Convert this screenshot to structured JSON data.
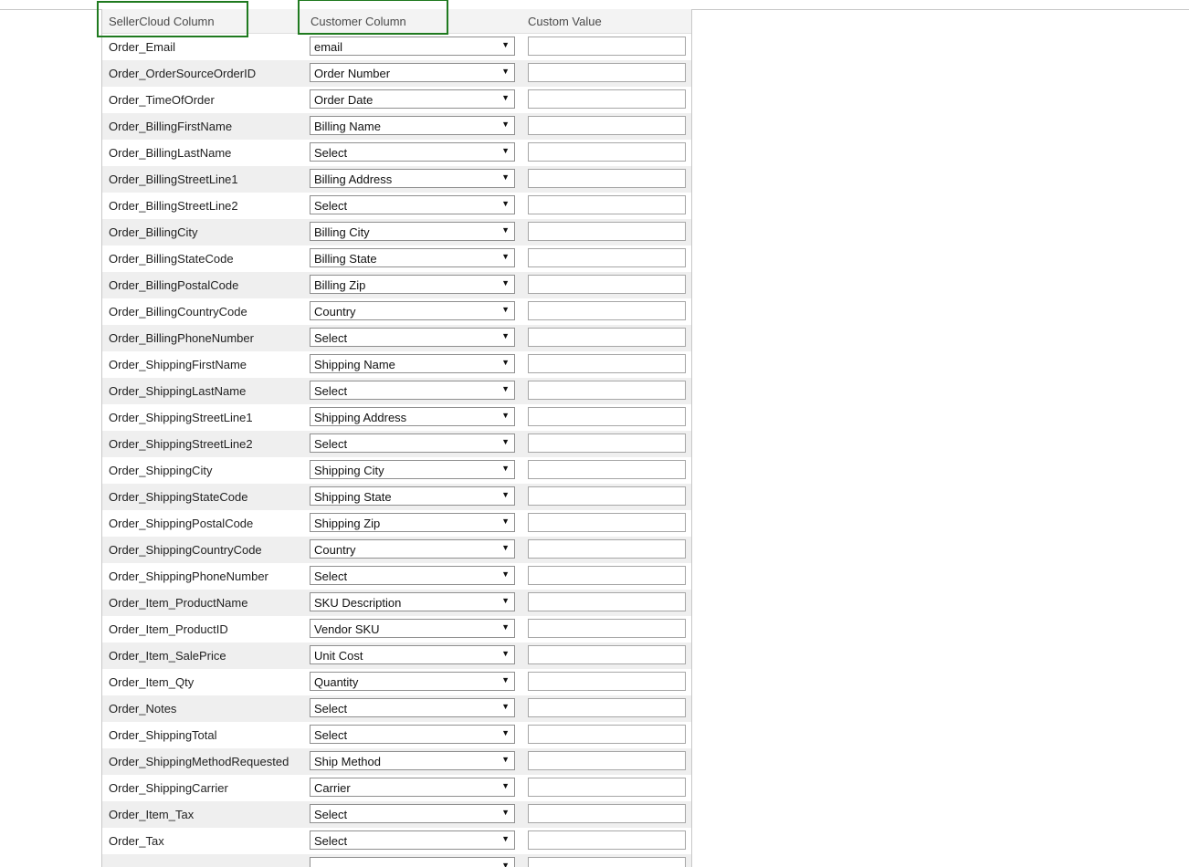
{
  "header": {
    "seller_col": "SellerCloud Column",
    "customer_col": "Customer Column",
    "custom_col": "Custom Value"
  },
  "rows": [
    {
      "field": "Order_Email",
      "mapped": "email",
      "custom": ""
    },
    {
      "field": "Order_OrderSourceOrderID",
      "mapped": "Order Number",
      "custom": ""
    },
    {
      "field": "Order_TimeOfOrder",
      "mapped": "Order Date",
      "custom": ""
    },
    {
      "field": "Order_BillingFirstName",
      "mapped": "Billing Name",
      "custom": ""
    },
    {
      "field": "Order_BillingLastName",
      "mapped": "Select",
      "custom": ""
    },
    {
      "field": "Order_BillingStreetLine1",
      "mapped": "Billing Address",
      "custom": ""
    },
    {
      "field": "Order_BillingStreetLine2",
      "mapped": "Select",
      "custom": ""
    },
    {
      "field": "Order_BillingCity",
      "mapped": "Billing City",
      "custom": ""
    },
    {
      "field": "Order_BillingStateCode",
      "mapped": "Billing State",
      "custom": ""
    },
    {
      "field": "Order_BillingPostalCode",
      "mapped": "Billing Zip",
      "custom": ""
    },
    {
      "field": "Order_BillingCountryCode",
      "mapped": "Country",
      "custom": ""
    },
    {
      "field": "Order_BillingPhoneNumber",
      "mapped": "Select",
      "custom": ""
    },
    {
      "field": "Order_ShippingFirstName",
      "mapped": "Shipping Name",
      "custom": ""
    },
    {
      "field": "Order_ShippingLastName",
      "mapped": "Select",
      "custom": ""
    },
    {
      "field": "Order_ShippingStreetLine1",
      "mapped": "Shipping Address",
      "custom": ""
    },
    {
      "field": "Order_ShippingStreetLine2",
      "mapped": "Select",
      "custom": ""
    },
    {
      "field": "Order_ShippingCity",
      "mapped": "Shipping City",
      "custom": ""
    },
    {
      "field": "Order_ShippingStateCode",
      "mapped": "Shipping State",
      "custom": ""
    },
    {
      "field": "Order_ShippingPostalCode",
      "mapped": "Shipping Zip",
      "custom": ""
    },
    {
      "field": "Order_ShippingCountryCode",
      "mapped": "Country",
      "custom": ""
    },
    {
      "field": "Order_ShippingPhoneNumber",
      "mapped": "Select",
      "custom": ""
    },
    {
      "field": "Order_Item_ProductName",
      "mapped": "SKU Description",
      "custom": ""
    },
    {
      "field": "Order_Item_ProductID",
      "mapped": "Vendor SKU",
      "custom": ""
    },
    {
      "field": "Order_Item_SalePrice",
      "mapped": "Unit Cost",
      "custom": ""
    },
    {
      "field": "Order_Item_Qty",
      "mapped": "Quantity",
      "custom": ""
    },
    {
      "field": "Order_Notes",
      "mapped": "Select",
      "custom": ""
    },
    {
      "field": "Order_ShippingTotal",
      "mapped": "Select",
      "custom": ""
    },
    {
      "field": "Order_ShippingMethodRequested",
      "mapped": "Ship Method",
      "custom": ""
    },
    {
      "field": "Order_ShippingCarrier",
      "mapped": "Carrier",
      "custom": ""
    },
    {
      "field": "Order_Item_Tax",
      "mapped": "Select",
      "custom": ""
    },
    {
      "field": "Order_Tax",
      "mapped": "Select",
      "custom": ""
    },
    {
      "field": "",
      "mapped": "",
      "custom": ""
    }
  ],
  "dropdown_arrow": "▼",
  "colors": {
    "highlight_border": "#1f7a1f",
    "row_alt": "#efefef",
    "header_bg": "#f3f3f3"
  }
}
